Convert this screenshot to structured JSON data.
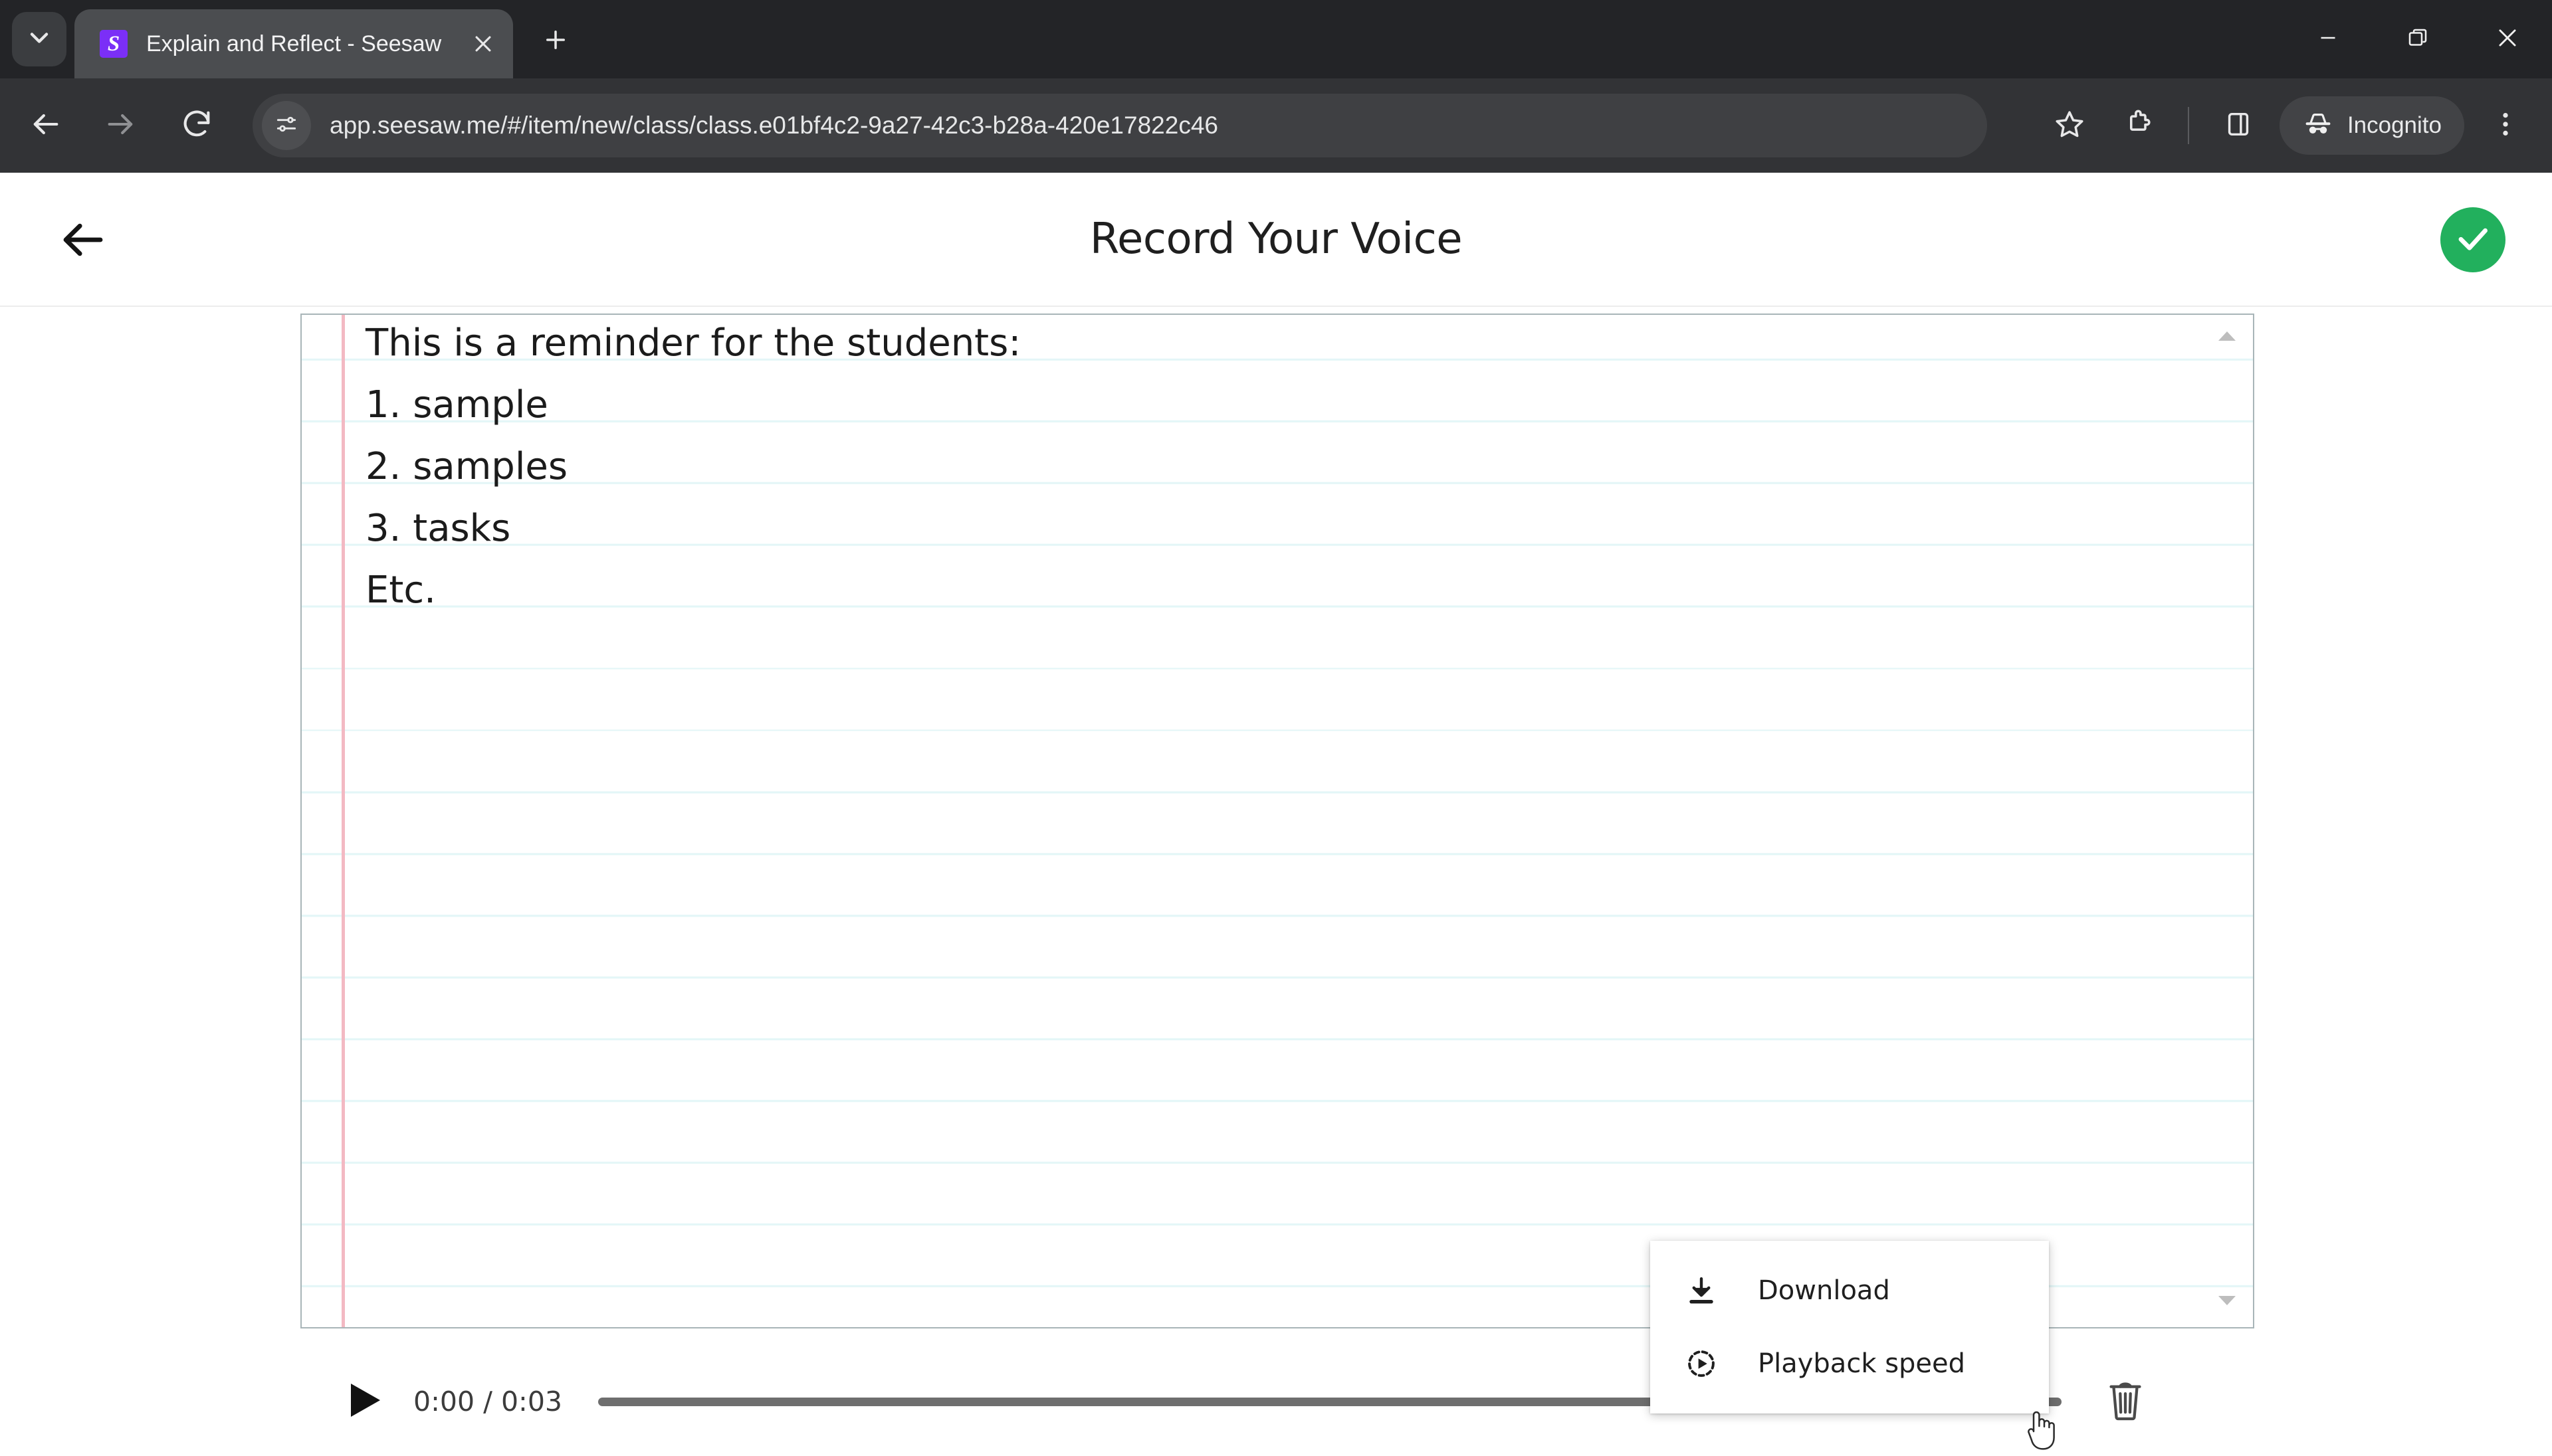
{
  "browser": {
    "tab": {
      "title": "Explain and Reflect - Seesaw",
      "favicon_letter": "S",
      "favicon_color": "#7b2ff7"
    },
    "tablist_icon": "chevron-down-icon",
    "new_tab_icon": "plus-icon",
    "window_controls": {
      "minimize": "minimize-icon",
      "restore": "restore-icon",
      "close": "close-icon"
    },
    "toolbar": {
      "back_icon": "back-arrow-icon",
      "forward_icon": "forward-arrow-icon",
      "reload_icon": "reload-icon",
      "site_info_icon": "site-settings-icon",
      "url": "app.seesaw.me/#/item/new/class/class.e01bf4c2-9a27-42c3-b28a-420e17822c46",
      "bookmark_icon": "star-icon",
      "extensions_icon": "puzzle-piece-icon",
      "side_panel_icon": "side-panel-icon",
      "incognito_icon": "incognito-icon",
      "incognito_label": "Incognito",
      "menu_icon": "three-dot-menu-icon"
    }
  },
  "app": {
    "back_icon": "back-arrow-icon",
    "title": "Record Your Voice",
    "done_icon": "check-icon",
    "done_color": "#22b05d"
  },
  "notebook": {
    "scroll_up_icon": "triangle-up-icon",
    "scroll_down_icon": "triangle-down-icon",
    "margin_color": "#f3b9c3",
    "rule_color": "#e3f6f7",
    "lines": [
      "This is a reminder for the students:",
      "1. sample",
      "2. samples",
      "3. tasks",
      "Etc."
    ]
  },
  "player": {
    "play_icon": "play-icon",
    "current_time": "0:00",
    "duration": "0:03",
    "time_display": "0:00 / 0:03",
    "progress_percent": 0,
    "delete_icon": "trash-icon"
  },
  "context_menu": {
    "items": [
      {
        "label": "Download",
        "icon": "download-icon"
      },
      {
        "label": "Playback speed",
        "icon": "playback-speed-icon"
      }
    ]
  },
  "cursor": {
    "icon": "pointing-hand-cursor"
  }
}
